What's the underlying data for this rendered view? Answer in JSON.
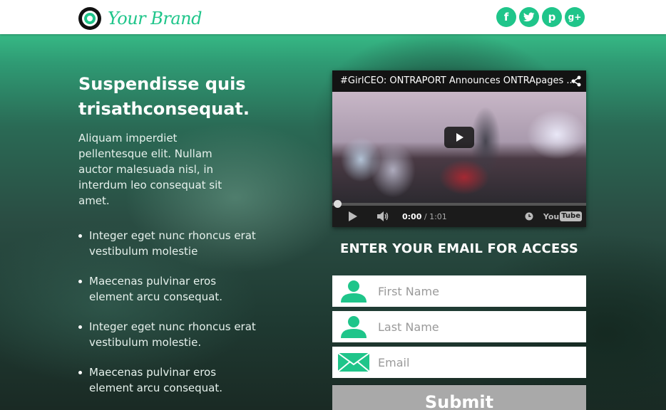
{
  "header": {
    "brand_name": "Your Brand",
    "brand_logo_icon": "ring-logo",
    "social": [
      {
        "name": "facebook",
        "glyph": "f"
      },
      {
        "name": "twitter",
        "glyph": "t"
      },
      {
        "name": "pinterest",
        "glyph": "p"
      },
      {
        "name": "google-plus",
        "glyph": "g+"
      }
    ]
  },
  "hero": {
    "headline": "Suspendisse quis trisathconsequat.",
    "intro": "Aliquam imperdiet pellentesque elit. Nullam auctor malesuada nisl, in interdum leo consequat sit amet.",
    "bullets": [
      "Integer eget nunc rhoncus erat vestibulum molestie",
      "Maecenas pulvinar eros element arcu consequat.",
      "Integer eget nunc rhoncus erat vestibulum molestie.",
      "Maecenas pulvinar eros element arcu consequat."
    ]
  },
  "video": {
    "title": "#GirlCEO: ONTRAPORT Announces ONTRApages ...",
    "current_time": "0:00",
    "duration": "1:01",
    "time_separator": " / ",
    "progress_percent": 0,
    "logo_you": "You",
    "logo_tube": "Tube"
  },
  "form": {
    "heading": "ENTER YOUR EMAIL FOR ACCESS",
    "first_name_placeholder": "First Name",
    "last_name_placeholder": "Last Name",
    "email_placeholder": "Email",
    "submit_label": "Submit"
  },
  "colors": {
    "accent": "#1fc58a",
    "submit_bg": "#a9a9a9",
    "header_bg": "#ffffff"
  }
}
